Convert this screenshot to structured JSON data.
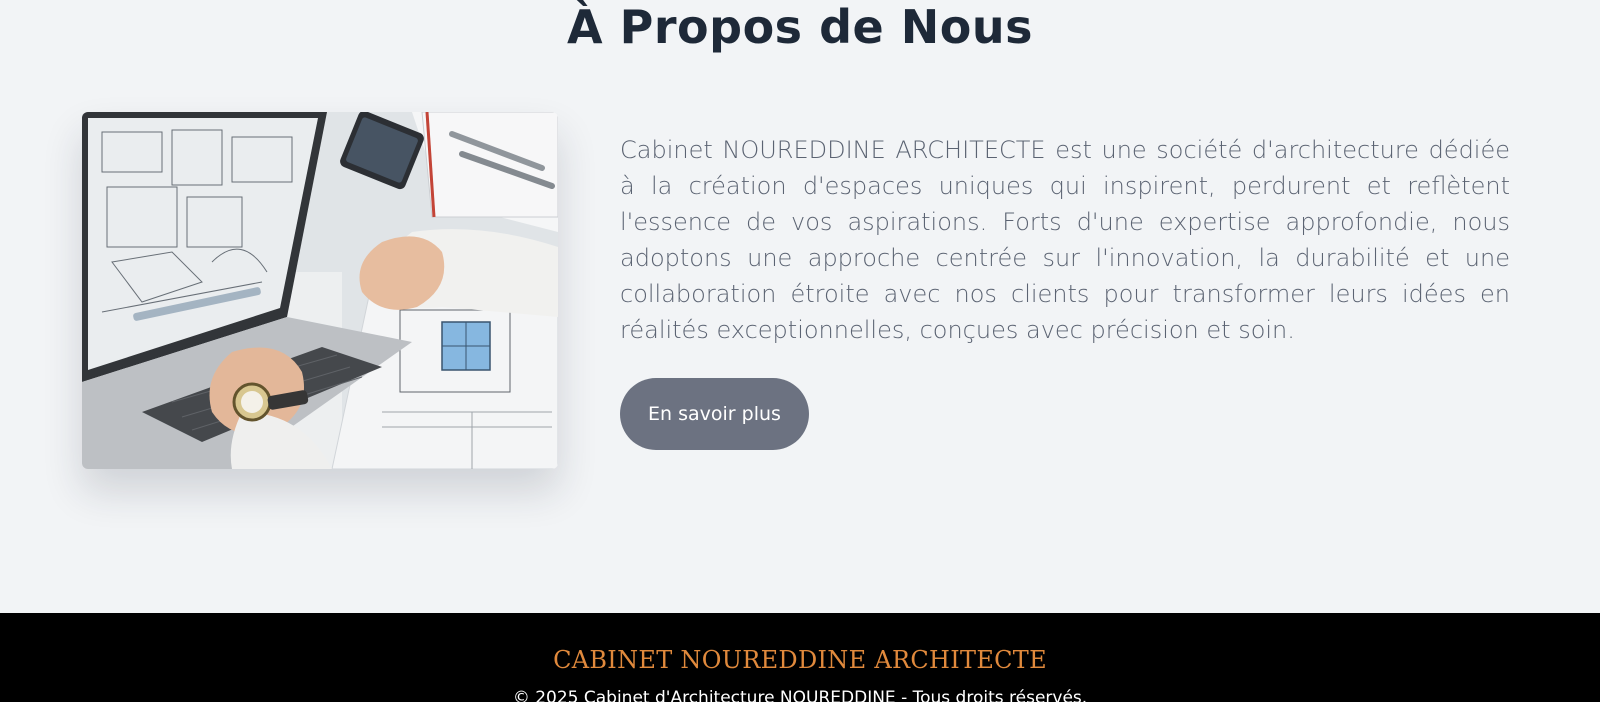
{
  "about": {
    "title": "À Propos de Nous",
    "paragraph": "Cabinet NOUREDDINE ARCHITECTE est une société d'architecture dédiée à la création d'espaces uniques qui inspirent, perdurent et reflètent l'essence de vos aspirations. Forts d'une expertise approfondie, nous adoptons une approche centrée sur l'innovation, la durabilité et une collaboration étroite avec nos clients pour transformer leurs idées en réalités exceptionnelles, conçues avec précision et soin.",
    "button_label": "En savoir plus",
    "image_subject": "laptop-hands-architectural-plans-photo"
  },
  "footer": {
    "brand": "CABINET NOUREDDINE ARCHITECTE",
    "copyright": "© 2025 Cabinet d'Architecture NOUREDDINE - Tous droits réservés."
  },
  "colors": {
    "background": "#f2f4f6",
    "title": "#1e2938",
    "body_text": "#5b6372",
    "button": "#6c7281",
    "footer_bg": "#000000",
    "footer_brand": "#e0893c"
  }
}
